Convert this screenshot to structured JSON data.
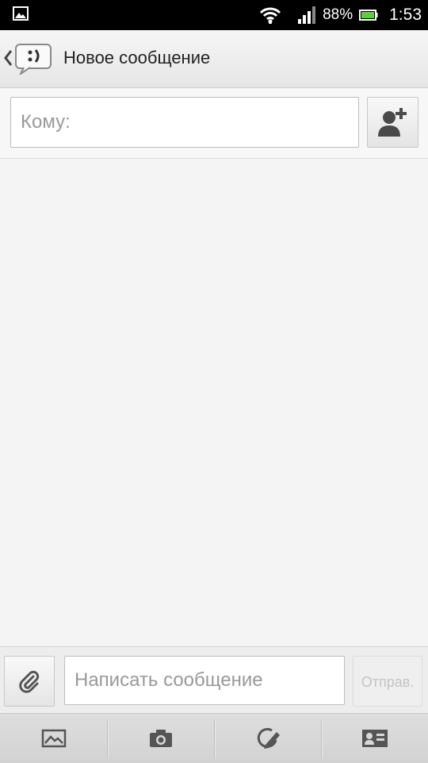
{
  "status_bar": {
    "battery_percent": "88%",
    "time": "1:53",
    "icons": [
      "picture-notification-icon",
      "wifi-icon",
      "signal-icon",
      "battery-icon"
    ]
  },
  "action_bar": {
    "title": "Новое сообщение",
    "icons": [
      "back-chevron-icon",
      "messaging-app-icon"
    ]
  },
  "recipient": {
    "placeholder": "Кому:",
    "add_contact_icon": "add-contact-icon"
  },
  "compose": {
    "placeholder": "Написать сообщение",
    "send_label": "Отправ.",
    "attach_icon": "paperclip-icon"
  },
  "toolbar": {
    "icons": [
      "picture-icon",
      "camera-icon",
      "draw-icon",
      "contact-card-icon"
    ]
  },
  "colors": {
    "status_bar_bg": "#000000",
    "background": "#f4f4f4",
    "placeholder_text": "#999999",
    "send_disabled_text": "#c4c4c4"
  }
}
